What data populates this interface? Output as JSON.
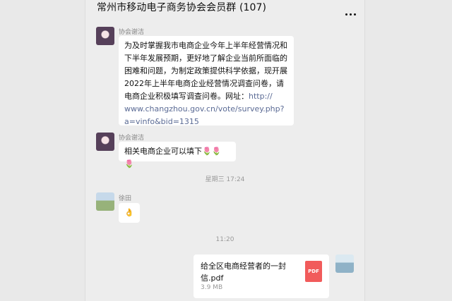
{
  "header": {
    "title": "常州市移动电子商务协会会员群 (107)",
    "more_icon": "more-icon"
  },
  "messages": [
    {
      "sender": "协会谢洁",
      "lines": [
        "为及时掌握我市电商企业今年上半年经营情况和",
        "下半年发展预期，更好地了解企业当前所面临的",
        "困难和问题，为制定政策提供科学依据，现开展",
        "2022年上半年电商企业经营情况调查问卷，请",
        "电商企业积极填写调查问卷。网址："
      ],
      "link_inline": "http://",
      "link_lines": [
        "www.changzhou.gov.cn/vote/survey.php?",
        "a=vinfo&bid=1315"
      ]
    },
    {
      "sender": "协会谢洁",
      "text": "相关电商企业可以填下🌷🌷🌷"
    },
    {
      "timestamp": "星期三 17:24"
    },
    {
      "sender": "徐田",
      "text": "👌"
    },
    {
      "timestamp": "11:20"
    },
    {
      "file_name_lines": [
        "给全区电商经营者的一封",
        "信.pdf"
      ],
      "file_size": "3.9 MB",
      "file_badge": "PDF"
    }
  ]
}
